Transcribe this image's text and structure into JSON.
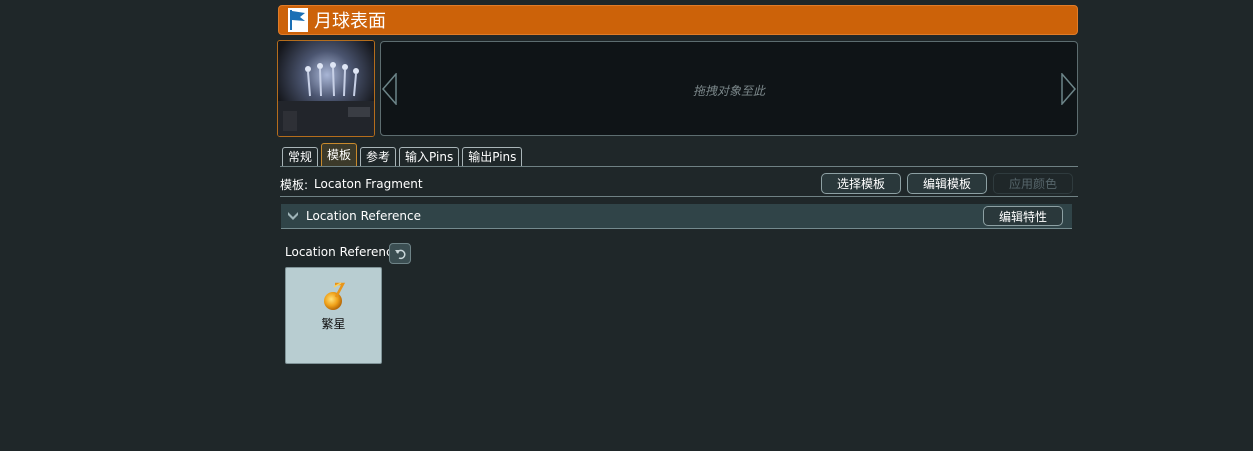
{
  "header": {
    "title": "月球表面",
    "icon": "flag-icon",
    "accent": "#cc6209"
  },
  "dropzone": {
    "hint": "拖拽对象至此"
  },
  "tabs": [
    {
      "label": "常规",
      "active": false
    },
    {
      "label": "模板",
      "active": true
    },
    {
      "label": "参考",
      "active": false
    },
    {
      "label": "输入Pins",
      "active": false
    },
    {
      "label": "输出Pins",
      "active": false
    }
  ],
  "template": {
    "label": "模板:",
    "value": "Locaton Fragment",
    "select_label": "选择模板",
    "edit_label": "编辑模板",
    "apply_color_label": "应用颜色"
  },
  "section": {
    "title": "Location Reference",
    "edit_props_label": "编辑特性"
  },
  "property": {
    "label": "Location Reference",
    "reset_icon": "undo-icon"
  },
  "card": {
    "label": "繁星",
    "icon": "planet-icon"
  }
}
